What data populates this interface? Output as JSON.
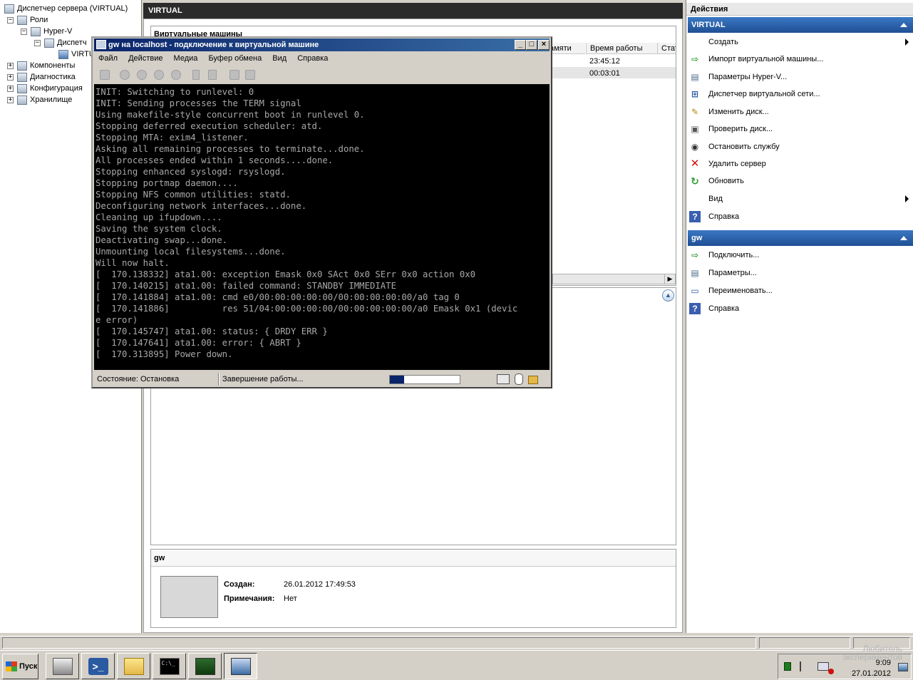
{
  "tree": {
    "items": [
      {
        "label": "Диспетчер сервера (VIRTUAL)",
        "level": 0,
        "toggle": ""
      },
      {
        "label": "Роли",
        "level": 1,
        "toggle": "−"
      },
      {
        "label": "Hyper-V",
        "level": 2,
        "toggle": "−"
      },
      {
        "label": "Диспетч",
        "level": 3,
        "toggle": "−"
      },
      {
        "label": "VIRTU",
        "level": 4,
        "toggle": ""
      },
      {
        "label": "Компоненты",
        "level": 1,
        "toggle": "+"
      },
      {
        "label": "Диагностика",
        "level": 1,
        "toggle": "+"
      },
      {
        "label": "Конфигурация",
        "level": 1,
        "toggle": "+"
      },
      {
        "label": "Хранилище",
        "level": 1,
        "toggle": "+"
      }
    ]
  },
  "center": {
    "title": "VIRTUAL",
    "vm_panel_title": "Виртуальные машины",
    "columns": [
      "амяти",
      "Время работы",
      "Стат"
    ],
    "rows": [
      {
        "uptime": "23:45:12"
      },
      {
        "uptime": "00:03:01"
      }
    ],
    "details": {
      "title": "gw",
      "created_label": "Создан:",
      "created_value": "26.01.2012 17:49:53",
      "notes_label": "Примечания:",
      "notes_value": "Нет"
    }
  },
  "actions": {
    "header": "Действия",
    "sections": [
      {
        "title": "VIRTUAL",
        "items": [
          {
            "label": "Создать",
            "icon": "blank",
            "submenu": true
          },
          {
            "label": "Импорт виртуальной машины...",
            "icon": "import-icon"
          },
          {
            "label": "Параметры Hyper-V...",
            "icon": "settings-icon"
          },
          {
            "label": "Диспетчер виртуальной сети...",
            "icon": "network-icon"
          },
          {
            "label": "Изменить диск...",
            "icon": "edit-disk-icon"
          },
          {
            "label": "Проверить диск...",
            "icon": "inspect-disk-icon"
          },
          {
            "label": "Остановить службу",
            "icon": "stop-icon"
          },
          {
            "label": "Удалить сервер",
            "icon": "delete-icon"
          },
          {
            "label": "Обновить",
            "icon": "refresh-icon"
          },
          {
            "label": "Вид",
            "icon": "blank",
            "submenu": true
          },
          {
            "label": "Справка",
            "icon": "help-icon"
          }
        ]
      },
      {
        "title": "gw",
        "items": [
          {
            "label": "Подключить...",
            "icon": "connect-icon"
          },
          {
            "label": "Параметры...",
            "icon": "settings-icon"
          },
          {
            "label": "Переименовать...",
            "icon": "rename-icon"
          },
          {
            "label": "Справка",
            "icon": "help-icon"
          }
        ]
      }
    ]
  },
  "vm_window": {
    "title": "gw на localhost - подключение к виртуальной машине",
    "menu": [
      "Файл",
      "Действие",
      "Медиа",
      "Буфер обмена",
      "Вид",
      "Справка"
    ],
    "console_lines": [
      "INIT: Switching to runlevel: 0",
      "INIT: Sending processes the TERM signal",
      "Using makefile-style concurrent boot in runlevel 0.",
      "Stopping deferred execution scheduler: atd.",
      "Stopping MTA: exim4_listener.",
      "Asking all remaining processes to terminate...done.",
      "All processes ended within 1 seconds....done.",
      "Stopping enhanced syslogd: rsyslogd.",
      "Stopping portmap daemon....",
      "Stopping NFS common utilities: statd.",
      "Deconfiguring network interfaces...done.",
      "Cleaning up ifupdown....",
      "Saving the system clock.",
      "Deactivating swap...done.",
      "Unmounting local filesystems...done.",
      "Will now halt.",
      "[  170.138332] ata1.00: exception Emask 0x0 SAct 0x0 SErr 0x0 action 0x0",
      "[  170.140215] ata1.00: failed command: STANDBY IMMEDIATE",
      "[  170.141884] ata1.00: cmd e0/00:00:00:00:00/00:00:00:00:00/a0 tag 0",
      "[  170.141886]          res 51/04:00:00:00:00/00:00:00:00:00/a0 Emask 0x1 (devic",
      "e error)",
      "[  170.145747] ata1.00: status: { DRDY ERR }",
      "[  170.147641] ata1.00: error: { ABRT }",
      "[  170.313895] Power down."
    ],
    "status_state": "Состояние: Остановка",
    "status_action": "Завершение работы...",
    "progress": 0.2
  },
  "taskbar": {
    "start_label": "Пуск",
    "clock_time": "9:09",
    "clock_date": "27.01.2012",
    "watermark": "Любитель экспериментов"
  }
}
